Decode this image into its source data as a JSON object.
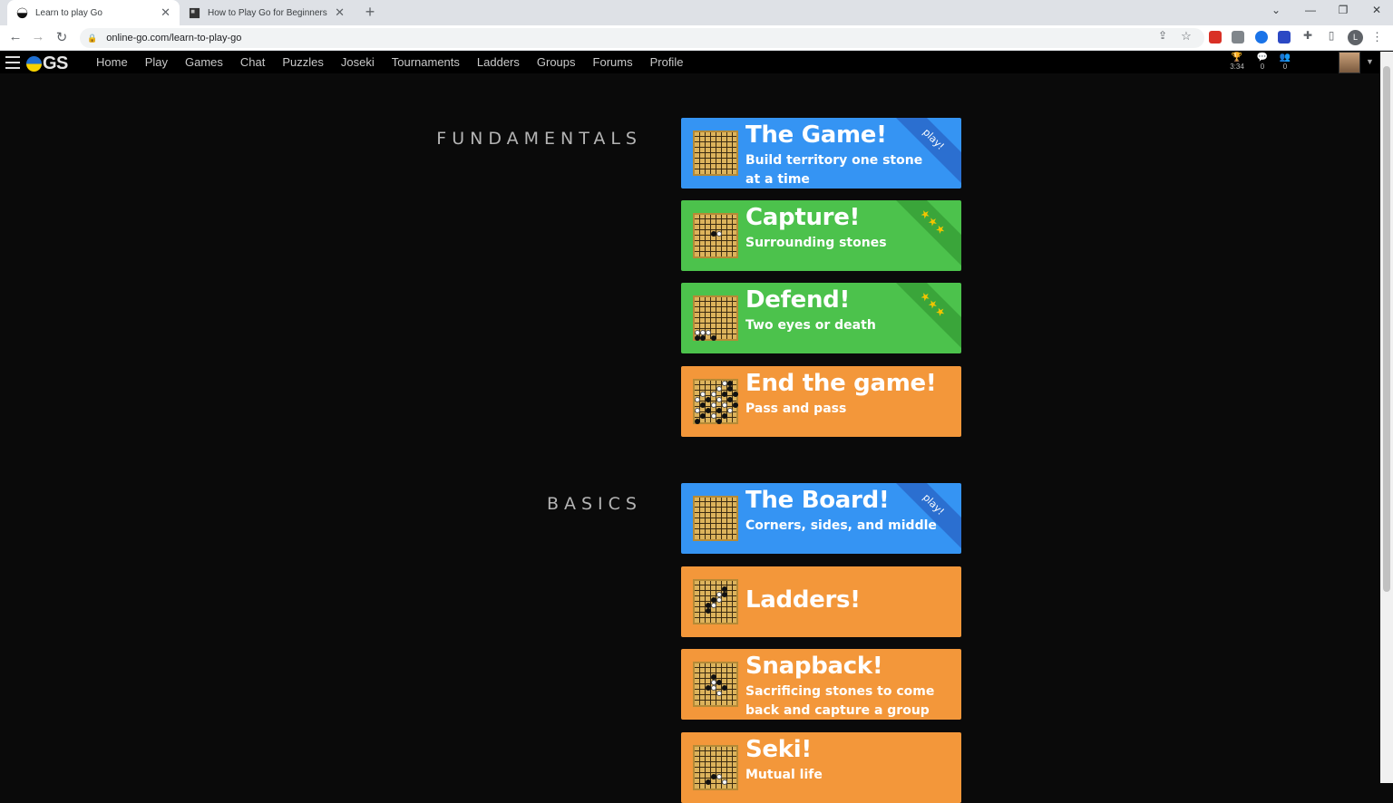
{
  "browser": {
    "tabs": [
      {
        "title": "Learn to play Go",
        "active": true
      },
      {
        "title": "How to Play Go for Beginners – G",
        "active": false
      }
    ],
    "url": "online-go.com/learn-to-play-go",
    "profile_initial": "L"
  },
  "nav": {
    "logo_text": "GS",
    "links": [
      "Home",
      "Play",
      "Games",
      "Chat",
      "Puzzles",
      "Joseki",
      "Tournaments",
      "Ladders",
      "Groups",
      "Forums",
      "Profile"
    ],
    "stats": [
      {
        "icon": "trophy-icon",
        "value": "3:34"
      },
      {
        "icon": "chat-icon",
        "value": "0"
      },
      {
        "icon": "people-icon",
        "value": "0"
      }
    ]
  },
  "sections": [
    {
      "title": "FUNDAMENTALS",
      "cards": [
        {
          "title": "The Game!",
          "subtitle": "Build territory one stone at a time",
          "color": "#3594f3",
          "badge": "play!"
        },
        {
          "title": "Capture!",
          "subtitle": "Surrounding stones",
          "color": "#4cc24c",
          "badge": "★★★"
        },
        {
          "title": "Defend!",
          "subtitle": "Two eyes or death",
          "color": "#4cc24c",
          "badge": "★★★"
        },
        {
          "title": "End the game!",
          "subtitle": "Pass and pass",
          "color": "#f3973a",
          "badge": ""
        }
      ]
    },
    {
      "title": "BASICS",
      "cards": [
        {
          "title": "The Board!",
          "subtitle": "Corners, sides, and middle",
          "color": "#3594f3",
          "badge": "play!"
        },
        {
          "title": "Ladders!",
          "subtitle": "",
          "color": "#f3973a",
          "badge": ""
        },
        {
          "title": "Snapback!",
          "subtitle": "Sacrificing stones to come back and capture a group",
          "color": "#f3973a",
          "badge": ""
        },
        {
          "title": "Seki!",
          "subtitle": "Mutual life",
          "color": "#f3973a",
          "badge": ""
        }
      ]
    }
  ]
}
